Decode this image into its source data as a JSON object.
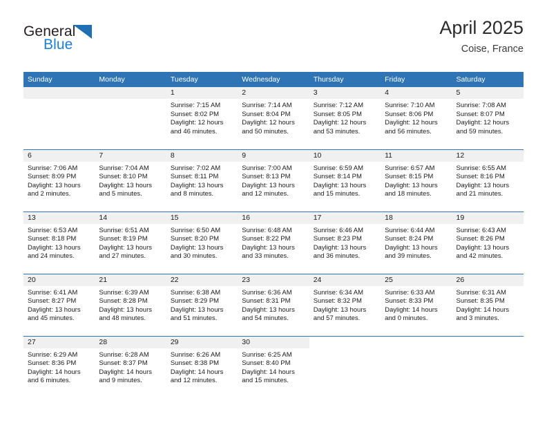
{
  "logo": {
    "word_one": "General",
    "word_two": "Blue",
    "triangle_color": "#1f6fb2",
    "blue_text_color": "#1b7fd4",
    "icon": "triangle-logo-icon"
  },
  "header": {
    "title": "April 2025",
    "subtitle": "Coise, France"
  },
  "theme": {
    "header_blue": "#2f75b5",
    "daynum_band": "#f0f0f0",
    "text": "#1a1a1a"
  },
  "weekday_headers": [
    "Sunday",
    "Monday",
    "Tuesday",
    "Wednesday",
    "Thursday",
    "Friday",
    "Saturday"
  ],
  "labels": {
    "sunrise_prefix": "Sunrise:",
    "sunset_prefix": "Sunset:",
    "daylight_prefix": "Daylight:"
  },
  "weeks": [
    [
      {
        "day": "",
        "empty": true
      },
      {
        "day": "",
        "empty": true
      },
      {
        "day": "1",
        "sunrise": "Sunrise: 7:15 AM",
        "sunset": "Sunset: 8:02 PM",
        "daylight_1": "Daylight: 12 hours",
        "daylight_2": "and 46 minutes."
      },
      {
        "day": "2",
        "sunrise": "Sunrise: 7:14 AM",
        "sunset": "Sunset: 8:04 PM",
        "daylight_1": "Daylight: 12 hours",
        "daylight_2": "and 50 minutes."
      },
      {
        "day": "3",
        "sunrise": "Sunrise: 7:12 AM",
        "sunset": "Sunset: 8:05 PM",
        "daylight_1": "Daylight: 12 hours",
        "daylight_2": "and 53 minutes."
      },
      {
        "day": "4",
        "sunrise": "Sunrise: 7:10 AM",
        "sunset": "Sunset: 8:06 PM",
        "daylight_1": "Daylight: 12 hours",
        "daylight_2": "and 56 minutes."
      },
      {
        "day": "5",
        "sunrise": "Sunrise: 7:08 AM",
        "sunset": "Sunset: 8:07 PM",
        "daylight_1": "Daylight: 12 hours",
        "daylight_2": "and 59 minutes."
      }
    ],
    [
      {
        "day": "6",
        "sunrise": "Sunrise: 7:06 AM",
        "sunset": "Sunset: 8:09 PM",
        "daylight_1": "Daylight: 13 hours",
        "daylight_2": "and 2 minutes."
      },
      {
        "day": "7",
        "sunrise": "Sunrise: 7:04 AM",
        "sunset": "Sunset: 8:10 PM",
        "daylight_1": "Daylight: 13 hours",
        "daylight_2": "and 5 minutes."
      },
      {
        "day": "8",
        "sunrise": "Sunrise: 7:02 AM",
        "sunset": "Sunset: 8:11 PM",
        "daylight_1": "Daylight: 13 hours",
        "daylight_2": "and 8 minutes."
      },
      {
        "day": "9",
        "sunrise": "Sunrise: 7:00 AM",
        "sunset": "Sunset: 8:13 PM",
        "daylight_1": "Daylight: 13 hours",
        "daylight_2": "and 12 minutes."
      },
      {
        "day": "10",
        "sunrise": "Sunrise: 6:59 AM",
        "sunset": "Sunset: 8:14 PM",
        "daylight_1": "Daylight: 13 hours",
        "daylight_2": "and 15 minutes."
      },
      {
        "day": "11",
        "sunrise": "Sunrise: 6:57 AM",
        "sunset": "Sunset: 8:15 PM",
        "daylight_1": "Daylight: 13 hours",
        "daylight_2": "and 18 minutes."
      },
      {
        "day": "12",
        "sunrise": "Sunrise: 6:55 AM",
        "sunset": "Sunset: 8:16 PM",
        "daylight_1": "Daylight: 13 hours",
        "daylight_2": "and 21 minutes."
      }
    ],
    [
      {
        "day": "13",
        "sunrise": "Sunrise: 6:53 AM",
        "sunset": "Sunset: 8:18 PM",
        "daylight_1": "Daylight: 13 hours",
        "daylight_2": "and 24 minutes."
      },
      {
        "day": "14",
        "sunrise": "Sunrise: 6:51 AM",
        "sunset": "Sunset: 8:19 PM",
        "daylight_1": "Daylight: 13 hours",
        "daylight_2": "and 27 minutes."
      },
      {
        "day": "15",
        "sunrise": "Sunrise: 6:50 AM",
        "sunset": "Sunset: 8:20 PM",
        "daylight_1": "Daylight: 13 hours",
        "daylight_2": "and 30 minutes."
      },
      {
        "day": "16",
        "sunrise": "Sunrise: 6:48 AM",
        "sunset": "Sunset: 8:22 PM",
        "daylight_1": "Daylight: 13 hours",
        "daylight_2": "and 33 minutes."
      },
      {
        "day": "17",
        "sunrise": "Sunrise: 6:46 AM",
        "sunset": "Sunset: 8:23 PM",
        "daylight_1": "Daylight: 13 hours",
        "daylight_2": "and 36 minutes."
      },
      {
        "day": "18",
        "sunrise": "Sunrise: 6:44 AM",
        "sunset": "Sunset: 8:24 PM",
        "daylight_1": "Daylight: 13 hours",
        "daylight_2": "and 39 minutes."
      },
      {
        "day": "19",
        "sunrise": "Sunrise: 6:43 AM",
        "sunset": "Sunset: 8:26 PM",
        "daylight_1": "Daylight: 13 hours",
        "daylight_2": "and 42 minutes."
      }
    ],
    [
      {
        "day": "20",
        "sunrise": "Sunrise: 6:41 AM",
        "sunset": "Sunset: 8:27 PM",
        "daylight_1": "Daylight: 13 hours",
        "daylight_2": "and 45 minutes."
      },
      {
        "day": "21",
        "sunrise": "Sunrise: 6:39 AM",
        "sunset": "Sunset: 8:28 PM",
        "daylight_1": "Daylight: 13 hours",
        "daylight_2": "and 48 minutes."
      },
      {
        "day": "22",
        "sunrise": "Sunrise: 6:38 AM",
        "sunset": "Sunset: 8:29 PM",
        "daylight_1": "Daylight: 13 hours",
        "daylight_2": "and 51 minutes."
      },
      {
        "day": "23",
        "sunrise": "Sunrise: 6:36 AM",
        "sunset": "Sunset: 8:31 PM",
        "daylight_1": "Daylight: 13 hours",
        "daylight_2": "and 54 minutes."
      },
      {
        "day": "24",
        "sunrise": "Sunrise: 6:34 AM",
        "sunset": "Sunset: 8:32 PM",
        "daylight_1": "Daylight: 13 hours",
        "daylight_2": "and 57 minutes."
      },
      {
        "day": "25",
        "sunrise": "Sunrise: 6:33 AM",
        "sunset": "Sunset: 8:33 PM",
        "daylight_1": "Daylight: 14 hours",
        "daylight_2": "and 0 minutes."
      },
      {
        "day": "26",
        "sunrise": "Sunrise: 6:31 AM",
        "sunset": "Sunset: 8:35 PM",
        "daylight_1": "Daylight: 14 hours",
        "daylight_2": "and 3 minutes."
      }
    ],
    [
      {
        "day": "27",
        "sunrise": "Sunrise: 6:29 AM",
        "sunset": "Sunset: 8:36 PM",
        "daylight_1": "Daylight: 14 hours",
        "daylight_2": "and 6 minutes."
      },
      {
        "day": "28",
        "sunrise": "Sunrise: 6:28 AM",
        "sunset": "Sunset: 8:37 PM",
        "daylight_1": "Daylight: 14 hours",
        "daylight_2": "and 9 minutes."
      },
      {
        "day": "29",
        "sunrise": "Sunrise: 6:26 AM",
        "sunset": "Sunset: 8:38 PM",
        "daylight_1": "Daylight: 14 hours",
        "daylight_2": "and 12 minutes."
      },
      {
        "day": "30",
        "sunrise": "Sunrise: 6:25 AM",
        "sunset": "Sunset: 8:40 PM",
        "daylight_1": "Daylight: 14 hours",
        "daylight_2": "and 15 minutes."
      },
      {
        "day": "",
        "empty": true,
        "blank": true
      },
      {
        "day": "",
        "empty": true,
        "blank": true
      },
      {
        "day": "",
        "empty": true,
        "blank": true
      }
    ]
  ]
}
